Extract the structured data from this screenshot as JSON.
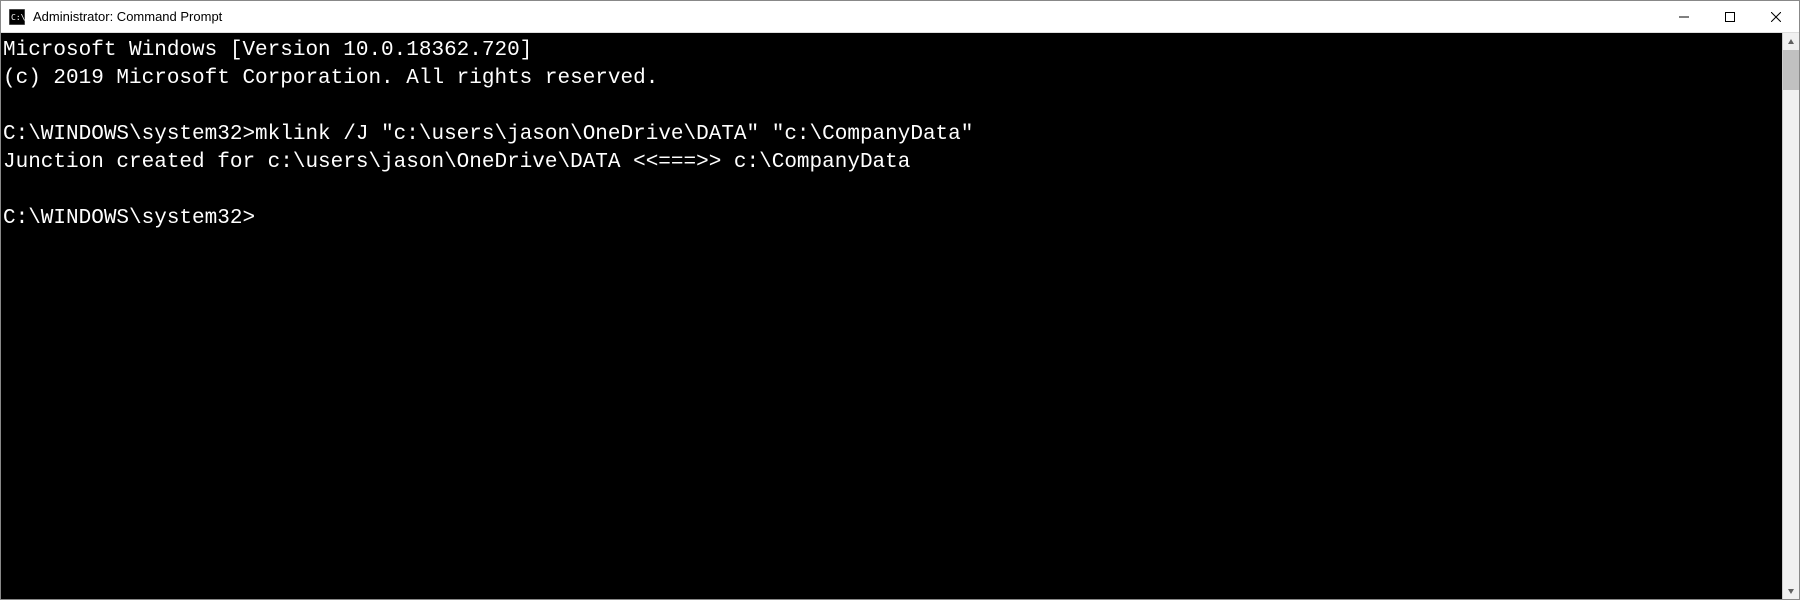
{
  "titlebar": {
    "title": "Administrator: Command Prompt"
  },
  "terminal": {
    "line1": "Microsoft Windows [Version 10.0.18362.720]",
    "line2": "(c) 2019 Microsoft Corporation. All rights reserved.",
    "prompt1": "C:\\WINDOWS\\system32>",
    "command": "mklink /J \"c:\\users\\jason\\OneDrive\\DATA\" \"c:\\CompanyData\"",
    "result": "Junction created for c:\\users\\jason\\OneDrive\\DATA <<===>> c:\\CompanyData",
    "prompt2": "C:\\WINDOWS\\system32>"
  }
}
